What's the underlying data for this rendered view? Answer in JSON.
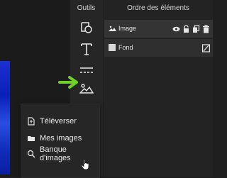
{
  "tools": {
    "title": "Outils",
    "items": [
      "shape-tool",
      "text-tool",
      "divider-tool",
      "image-tool"
    ]
  },
  "layers": {
    "title": "Ordre des éléments",
    "rows": [
      {
        "label": "Image",
        "selected": true
      },
      {
        "label": "Fond",
        "selected": false
      }
    ]
  },
  "image_menu": {
    "items": [
      {
        "label": "Téléverser",
        "icon": "upload-file-icon"
      },
      {
        "label": "Mes images",
        "icon": "folder-icon"
      },
      {
        "label": "Banque d'images",
        "icon": "search-icon"
      }
    ]
  },
  "colors": {
    "accent_arrow": "#6fd12a",
    "canvas_image": "#1d2fd0"
  }
}
